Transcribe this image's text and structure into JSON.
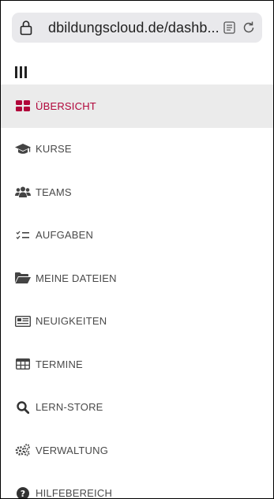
{
  "browser": {
    "url": "dbildungscloud.de/dashb...",
    "icons": [
      "lock-icon",
      "reader-icon",
      "reload-icon"
    ]
  },
  "menu_icon": "hamburger-icon",
  "nav": {
    "items": [
      {
        "label": "ÜBERSICHT",
        "icon": "dashboard-icon",
        "active": true
      },
      {
        "label": "KURSE",
        "icon": "graduation-cap-icon",
        "active": false
      },
      {
        "label": "TEAMS",
        "icon": "users-icon",
        "active": false
      },
      {
        "label": "AUFGABEN",
        "icon": "tasks-icon",
        "active": false
      },
      {
        "label": "MEINE DATEIEN",
        "icon": "folder-icon",
        "active": false
      },
      {
        "label": "NEUIGKEITEN",
        "icon": "newspaper-icon",
        "active": false
      },
      {
        "label": "TERMINE",
        "icon": "calendar-table-icon",
        "active": false
      },
      {
        "label": "LERN-STORE",
        "icon": "search-icon",
        "active": false
      },
      {
        "label": "VERWALTUNG",
        "icon": "cogs-icon",
        "active": false
      },
      {
        "label": "HILFEBEREICH",
        "icon": "help-icon",
        "active": false
      }
    ]
  },
  "colors": {
    "accent": "#b1063a",
    "text": "#4a4a4a",
    "active_bg": "#ebebeb",
    "urlbar_bg": "#e9e9ec"
  }
}
